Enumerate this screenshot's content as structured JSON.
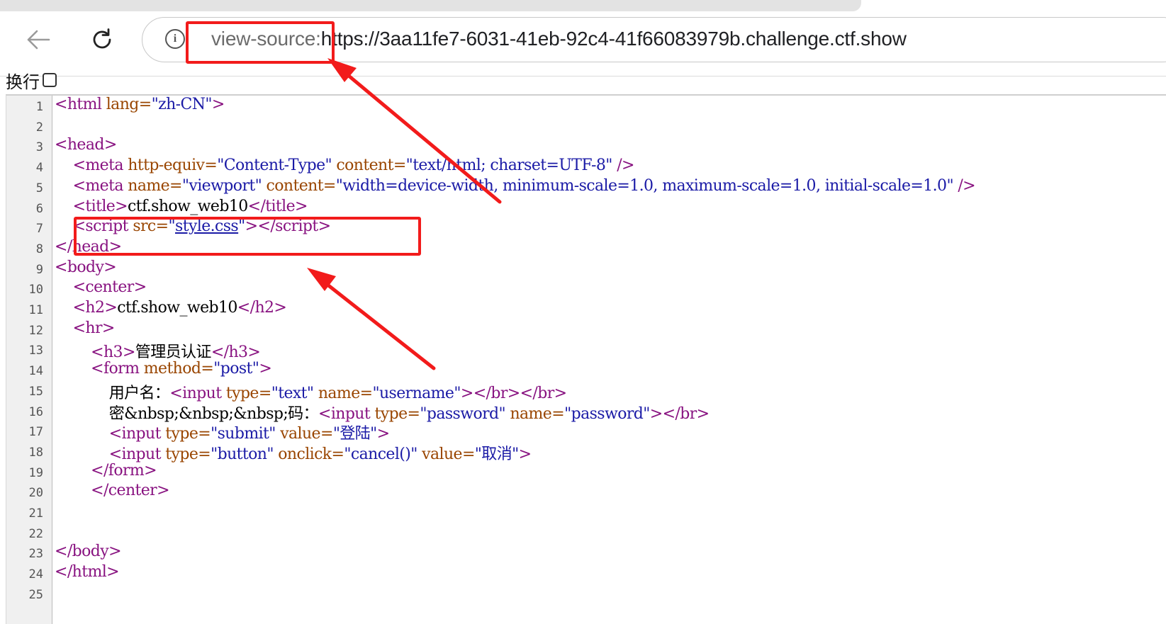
{
  "browser": {
    "url_scheme": "view-source:",
    "url_main": "https://3aa11fe7-6031-41eb-92c4-41f66083979b.challenge.ctf.show"
  },
  "view": {
    "wrap_label": "换行"
  },
  "source_lines": [
    {
      "n": "1",
      "html": "<span class='tag'>&lt;html</span> <span class='attr'>lang=</span><span class='val'>\"zh-CN\"</span><span class='tag'>&gt;</span>"
    },
    {
      "n": "2",
      "html": ""
    },
    {
      "n": "3",
      "html": "<span class='tag'>&lt;head&gt;</span>"
    },
    {
      "n": "4",
      "html": "    <span class='tag'>&lt;meta</span> <span class='attr'>http-equiv=</span><span class='val'>\"Content-Type\"</span> <span class='attr'>content=</span><span class='val'>\"text/html; charset=UTF-8\"</span> <span class='tag'>/&gt;</span>"
    },
    {
      "n": "5",
      "html": "    <span class='tag'>&lt;meta</span> <span class='attr'>name=</span><span class='val'>\"viewport\"</span> <span class='attr'>content=</span><span class='val'>\"width=device-width, minimum-scale=1.0, maximum-scale=1.0, initial-scale=1.0\"</span> <span class='tag'>/&gt;</span>"
    },
    {
      "n": "6",
      "html": "    <span class='tag'>&lt;title&gt;</span>ctf.show_web10<span class='tag'>&lt;/title&gt;</span>"
    },
    {
      "n": "7",
      "html": "    <span class='tag'>&lt;script</span> <span class='attr'>src=</span><span class='val'>\"</span><span class='link'>style.css</span><span class='val'>\"</span><span class='tag'>&gt;&lt;/script&gt;</span>"
    },
    {
      "n": "8",
      "html": "<span class='tag'>&lt;/head&gt;</span>"
    },
    {
      "n": "9",
      "html": "<span class='tag'>&lt;body&gt;</span>"
    },
    {
      "n": "10",
      "html": "    <span class='tag'>&lt;center&gt;</span>"
    },
    {
      "n": "11",
      "html": "    <span class='tag'>&lt;h2&gt;</span>ctf.show_web10<span class='tag'>&lt;/h2&gt;</span>"
    },
    {
      "n": "12",
      "html": "    <span class='tag'>&lt;hr&gt;</span>"
    },
    {
      "n": "13",
      "html": "        <span class='tag'>&lt;h3&gt;</span>管理员认证<span class='tag'>&lt;/h3&gt;</span>"
    },
    {
      "n": "14",
      "html": "        <span class='tag'>&lt;form</span> <span class='attr'>method=</span><span class='val'>\"post\"</span><span class='tag'>&gt;</span>"
    },
    {
      "n": "15",
      "html": "            用户名：<span class='tag'>&lt;input</span> <span class='attr'>type=</span><span class='val'>\"text\"</span> <span class='attr'>name=</span><span class='val'>\"username\"</span><span class='tag'>&gt;&lt;/br&gt;&lt;/br&gt;</span>"
    },
    {
      "n": "16",
      "html": "            密&amp;nbsp;&amp;nbsp;&amp;nbsp;码：<span class='tag'>&lt;input</span> <span class='attr'>type=</span><span class='val'>\"password\"</span> <span class='attr'>name=</span><span class='val'>\"password\"</span><span class='tag'>&gt;&lt;/br&gt;</span>"
    },
    {
      "n": "17",
      "html": "            <span class='tag'>&lt;input</span> <span class='attr'>type=</span><span class='val'>\"submit\"</span> <span class='attr'>value=</span><span class='val'>\"登陆\"</span><span class='tag'>&gt;</span>"
    },
    {
      "n": "18",
      "html": "            <span class='tag'>&lt;input</span> <span class='attr'>type=</span><span class='val'>\"button\"</span> <span class='attr'>onclick=</span><span class='val'>\"cancel()\"</span> <span class='attr'>value=</span><span class='val'>\"取消\"</span><span class='tag'>&gt;</span>"
    },
    {
      "n": "19",
      "html": "        <span class='tag'>&lt;/form&gt;</span>"
    },
    {
      "n": "20",
      "html": "        <span class='tag'>&lt;/center&gt;</span>"
    },
    {
      "n": "21",
      "html": ""
    },
    {
      "n": "22",
      "html": ""
    },
    {
      "n": "23",
      "html": "<span class='tag'>&lt;/body&gt;</span>"
    },
    {
      "n": "24",
      "html": "<span class='tag'>&lt;/html&gt;</span>"
    },
    {
      "n": "25",
      "html": ""
    }
  ],
  "colors": {
    "tag": "#881280",
    "attribute": "#994500",
    "value": "#1a1aa6",
    "annotation": "#f21b1b"
  },
  "icons": [
    "back-arrow-icon",
    "reload-icon",
    "info-icon"
  ]
}
